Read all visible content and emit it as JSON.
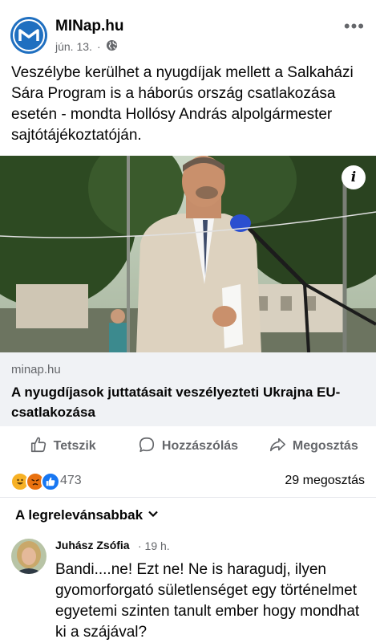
{
  "post": {
    "page_name": "MINap.hu",
    "date": "jún. 13.",
    "separator": "·",
    "visibility_icon": "globe-icon",
    "more_label": "•••",
    "text": "Veszélybe kerülhet a nyugdíjak mellett a Salkaházi Sára Program is a háborús ország csatlakozása esetén - mondta Hollósy András alpolgármester sajtótájékoztatóján."
  },
  "link": {
    "info_label": "i",
    "domain": "minap.hu",
    "title": "A nyugdíjasok juttatásait veszélyezteti Ukrajna EU-csatlakozása"
  },
  "actions": {
    "like": "Tetszik",
    "comment": "Hozzászólás",
    "share": "Megosztás"
  },
  "stats": {
    "reaction_icons": [
      "haha-icon",
      "angry-icon",
      "like-icon"
    ],
    "reaction_count": "473",
    "shares": "29 megosztás"
  },
  "comments": {
    "sort_label": "A legrelevánsabbak",
    "first": {
      "author": "Juhász Zsófia",
      "time": "· 19 h.",
      "text": "Bandi....ne! Ezt ne! Ne is haragudj, ilyen gyomorforgató sületlenséget egy történelmet egyetemi szinten tanult ember hogy mondhat ki a szájával?"
    }
  },
  "colors": {
    "brand_blue": "#1f6fc0",
    "secondary_text": "#65676b",
    "link_bg": "#f0f2f5",
    "like_blue": "#1877f2",
    "angry_orange": "#e9710f",
    "haha_yellow": "#f7b125"
  }
}
